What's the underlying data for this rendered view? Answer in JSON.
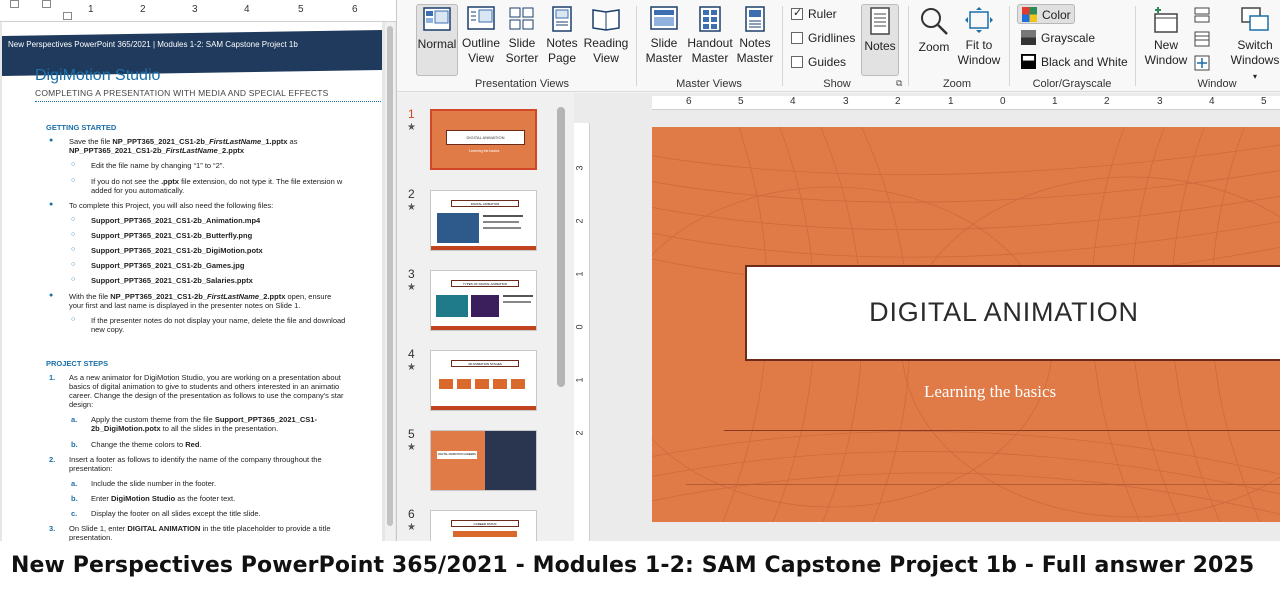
{
  "document": {
    "ruler_numbers": [
      "1",
      "2",
      "3",
      "4",
      "5",
      "6"
    ],
    "banner_text": "New Perspectives PowerPoint 365/2021 | Modules 1-2: SAM Capstone Project 1b",
    "title": "DigiMotion Studio",
    "subtitle": "COMPLETING A PRESENTATION WITH MEDIA AND SPECIAL EFFECTS",
    "getting_started": {
      "heading": "GETTING STARTED",
      "save_line_1_prefix": "Save the file ",
      "save_file_1": "NP_PPT365_2021_CS1-2b_",
      "save_file_1_italic": "FirstLastName",
      "save_file_1_suffix": "_1.pptx",
      "save_line_1_end": " as",
      "save_file_2": "NP_PPT365_2021_CS1-2b_",
      "save_file_2_italic": "FirstLastName",
      "save_file_2_suffix": "_2.pptx",
      "sub_1": "Edit the file name by changing “1” to “2”.",
      "sub_2_prefix": "If you do not see the ",
      "sub_2_bold": ".pptx",
      "sub_2_suffix": " file extension, do not type it. The file extension w",
      "sub_2_line2": "added for you automatically.",
      "complete_line": "To complete this Project, you will also need the following files:",
      "files": [
        "Support_PPT365_2021_CS1-2b_Animation.mp4",
        "Support_PPT365_2021_CS1-2b_Butterfly.png",
        "Support_PPT365_2021_CS1-2b_DigiMotion.potx",
        "Support_PPT365_2021_CS1-2b_Games.jpg",
        "Support_PPT365_2021_CS1-2b_Salaries.pptx"
      ],
      "with_prefix": "With the file ",
      "with_file": "NP_PPT365_2021_CS1-2b_",
      "with_file_italic": "FirstLastName",
      "with_file_suffix": "_2.pptx",
      "with_suffix": " open, ensure",
      "with_line2": "your first and last name is displayed in the presenter notes on Slide 1.",
      "notes_sub_1": "If the presenter notes do not display your name, delete the file and download",
      "notes_sub_2": "new copy."
    },
    "project_steps": {
      "heading": "PROJECT STEPS",
      "step1_num": "1.",
      "step1_l1": "As a new animator for DigiMotion Studio, you are working on a presentation about",
      "step1_l2": "basics of digital animation to give to students and others interested in an animatio",
      "step1_l3": "career. Change the design of the presentation as follows to use the company's star",
      "step1_l4": "design:",
      "step1a_num": "a.",
      "step1a_l1_prefix": "Apply the custom theme from the file ",
      "step1a_l1_bold": "Support_PPT365_2021_CS1-",
      "step1a_l2_bold": "2b_DigiMotion.potx",
      "step1a_l2_suffix": " to all the slides in the presentation.",
      "step1b_num": "b.",
      "step1b_prefix": "Change the theme colors to ",
      "step1b_bold": "Red",
      "step1b_suffix": ".",
      "step2_num": "2.",
      "step2_l1": "Insert a footer as follows to identify the name of the company throughout the",
      "step2_l2": "presentation:",
      "step2a_num": "a.",
      "step2a": "Include the slide number in the footer.",
      "step2b_num": "b.",
      "step2b_prefix": "Enter ",
      "step2b_bold": "DigiMotion Studio",
      "step2b_suffix": " as the footer text.",
      "step2c_num": "c.",
      "step2c": "Display the footer on all slides except the title slide.",
      "step3_num": "3.",
      "step3_prefix": "On Slide 1, enter ",
      "step3_bold": "DIGITAL ANIMATION",
      "step3_suffix": " in the title placeholder to provide a title",
      "step3_l2": "presentation."
    }
  },
  "ribbon": {
    "presentation_views": {
      "label": "Presentation Views",
      "normal": [
        "Normal"
      ],
      "outline": [
        "Outline",
        "View"
      ],
      "sorter": [
        "Slide",
        "Sorter"
      ],
      "notes_page": [
        "Notes",
        "Page"
      ],
      "reading": [
        "Reading",
        "View"
      ]
    },
    "master_views": {
      "label": "Master Views",
      "slide_master": [
        "Slide",
        "Master"
      ],
      "handout_master": [
        "Handout",
        "Master"
      ],
      "notes_master": [
        "Notes",
        "Master"
      ]
    },
    "show": {
      "label": "Show",
      "ruler": "Ruler",
      "gridlines": "Gridlines",
      "guides": "Guides",
      "notes": "Notes"
    },
    "zoom": {
      "label": "Zoom",
      "zoom": "Zoom",
      "fit": [
        "Fit to",
        "Window"
      ]
    },
    "color_grayscale": {
      "label": "Color/Grayscale",
      "color": "Color",
      "grayscale": "Grayscale",
      "bw": "Black and White"
    },
    "window": {
      "label": "Window",
      "new_window": [
        "New",
        "Window"
      ],
      "switch_windows": [
        "Switch",
        "Windows"
      ]
    }
  },
  "thumbnails": [
    {
      "num": "1",
      "title": "DIGITAL ANIMATION",
      "sub": "Learning the basics"
    },
    {
      "num": "2",
      "title": "DIGITAL ANIMATION"
    },
    {
      "num": "3",
      "title": "TYPES OF DIGITAL ANIMATION"
    },
    {
      "num": "4",
      "title": "3D ANIMATION STAGES"
    },
    {
      "num": "5",
      "title": "DIGITAL ANIMATION CAREERS"
    },
    {
      "num": "6",
      "title": "CAREER PATHS"
    }
  ],
  "h_ruler_numbers": [
    "6",
    "5",
    "4",
    "3",
    "2",
    "1",
    "0",
    "1",
    "2",
    "3",
    "4",
    "5",
    "6"
  ],
  "v_ruler_numbers": [
    "3",
    "2",
    "1",
    "0",
    "1",
    "2"
  ],
  "slide": {
    "title": "DIGITAL ANIMATION",
    "subtitle": "Learning the basics"
  },
  "caption": "New Perspectives PowerPoint 365/2021 - Modules 1-2: SAM Capstone Project 1b - Full answer 2025",
  "colors": {
    "accent": "#d24726",
    "slide_bg": "#e07a47",
    "doc_blue": "#1b6fa8",
    "banner": "#1f3a5c"
  }
}
